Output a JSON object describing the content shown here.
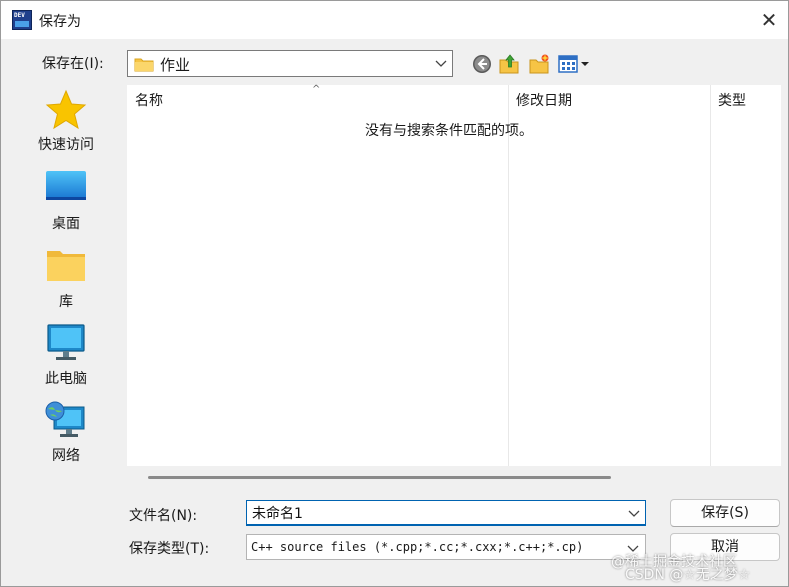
{
  "window": {
    "title": "保存为",
    "app_icon_text": "DEV",
    "close_symbol": "✕"
  },
  "toolbar": {
    "save_in_label": "保存在(I):",
    "location_value": "作业",
    "icons": [
      "back-icon",
      "up-folder-icon",
      "new-folder-icon",
      "view-menu-icon"
    ]
  },
  "places": [
    {
      "label": "快速访问",
      "icon": "star-icon"
    },
    {
      "label": "桌面",
      "icon": "desktop-icon"
    },
    {
      "label": "库",
      "icon": "folder-icon"
    },
    {
      "label": "此电脑",
      "icon": "monitor-icon"
    },
    {
      "label": "网络",
      "icon": "network-icon"
    }
  ],
  "filelist": {
    "columns": [
      "名称",
      "修改日期",
      "类型"
    ],
    "sort_indicator": "^",
    "empty_message": "没有与搜索条件匹配的项。"
  },
  "form": {
    "filename_label": "文件名(N):",
    "filename_value": "未命名1",
    "filetype_label": "保存类型(T):",
    "filetype_value": "C++ source files (*.cpp;*.cc;*.cxx;*.c++;*.cp)",
    "save_button": "保存(S)",
    "cancel_button": "取消"
  },
  "watermark": {
    "line1": "@稀土掘金技术社区",
    "line2": "CSDN @☆无之梦☆"
  },
  "colors": {
    "accent": "#0063b1",
    "folder": "#f6c445",
    "star": "#f9c400"
  }
}
